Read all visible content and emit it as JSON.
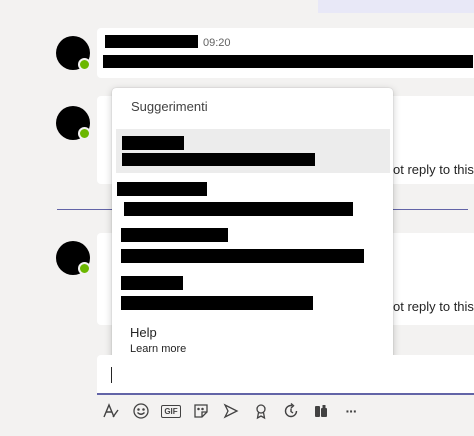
{
  "messages": [
    {
      "time": "09:20"
    },
    {
      "peek_text": "ot reply to this"
    },
    {
      "peek_text": "ot reply to this"
    }
  ],
  "popup": {
    "title": "Suggerimenti",
    "help_label": "Help",
    "help_link": "Learn more",
    "selected_index": 0
  },
  "compose": {
    "value": ""
  },
  "toolbar": {
    "format": "format-icon",
    "emoji": "emoji-icon",
    "gif_label": "GIF",
    "sticker": "sticker-icon",
    "meet": "meet-now-icon",
    "praise": "praise-icon",
    "loop": "loop-icon",
    "stream": "stream-icon",
    "more_label": "···"
  },
  "colors": {
    "accent": "#6264a7",
    "presence": "#6bb700",
    "background": "#f3f2f1",
    "selected_row": "#ececec"
  }
}
